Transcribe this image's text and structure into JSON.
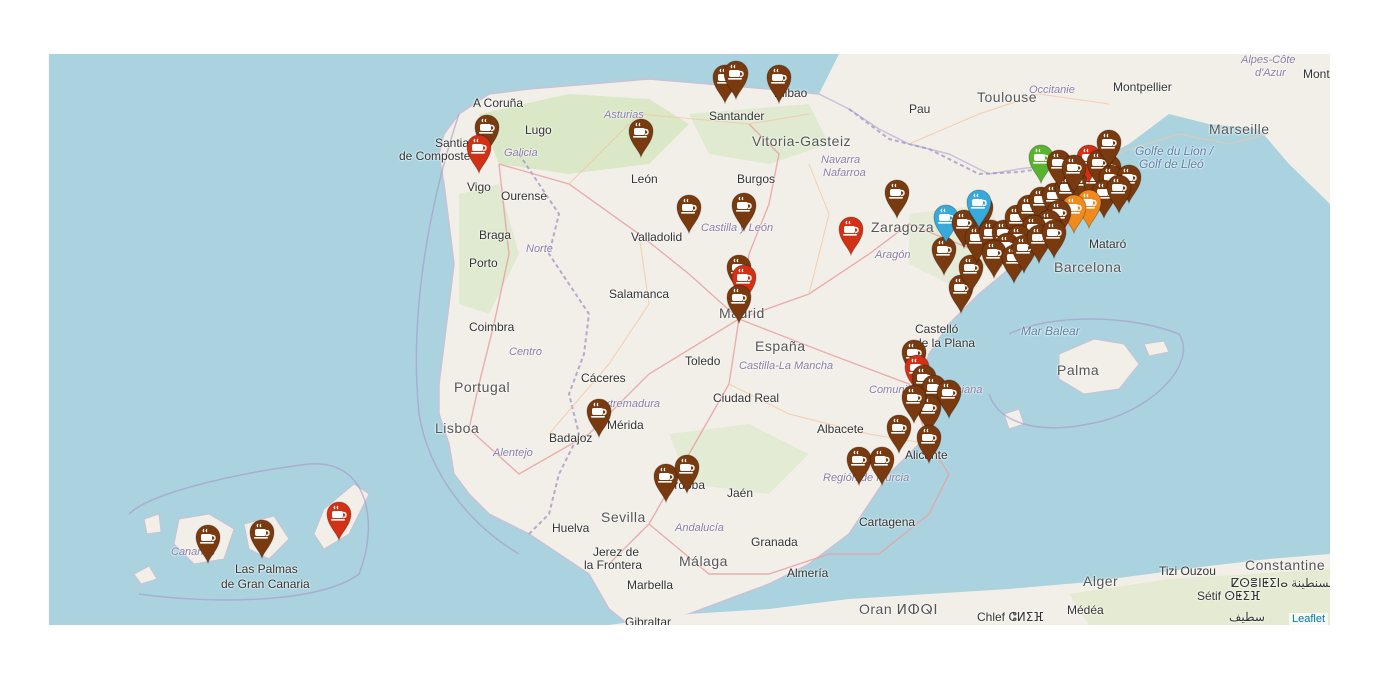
{
  "map": {
    "attribution": "Leaflet",
    "colors": {
      "sea": "#aad3df",
      "land": "#f2efe9",
      "green": "#cfe3b8",
      "marker_brown": "#7a3a0f",
      "marker_red": "#d33115",
      "marker_blue": "#38a9db",
      "marker_green": "#5ab430",
      "marker_orange": "#f08a1d"
    },
    "labels": [
      {
        "name": "label-a-coruna",
        "text": "A Coruña"
      },
      {
        "name": "label-lugo",
        "text": "Lugo"
      },
      {
        "name": "label-santiago-1",
        "text": "Santiago"
      },
      {
        "name": "label-santiago-2",
        "text": "de Compostela"
      },
      {
        "name": "label-galicia",
        "text": "Galicia"
      },
      {
        "name": "label-vigo",
        "text": "Vigo"
      },
      {
        "name": "label-ourense",
        "text": "Ourense"
      },
      {
        "name": "label-asturias",
        "text": "Asturias"
      },
      {
        "name": "label-santander",
        "text": "Santander"
      },
      {
        "name": "label-bilbao",
        "text": "Bilbao"
      },
      {
        "name": "label-vitoria",
        "text": "Vitoria-Gasteiz"
      },
      {
        "name": "label-navarra",
        "text": "Navarra"
      },
      {
        "name": "label-nafarroa",
        "text": "Nafarroa"
      },
      {
        "name": "label-pau",
        "text": "Pau"
      },
      {
        "name": "label-toulouse",
        "text": "Toulouse"
      },
      {
        "name": "label-occitanie",
        "text": "Occitanie"
      },
      {
        "name": "label-montpellier",
        "text": "Montpellier"
      },
      {
        "name": "label-marseille",
        "text": "Marseille"
      },
      {
        "name": "label-alpes",
        "text": "Alpes-Côte"
      },
      {
        "name": "label-azur",
        "text": "d'Azur"
      },
      {
        "name": "label-mont",
        "text": "Mont"
      },
      {
        "name": "label-golfe-lion",
        "text": "Golfe du Lion /"
      },
      {
        "name": "label-golf-lleo",
        "text": "Golf de Lleó"
      },
      {
        "name": "label-leon",
        "text": "León"
      },
      {
        "name": "label-burgos",
        "text": "Burgos"
      },
      {
        "name": "label-valladolid",
        "text": "Valladolid"
      },
      {
        "name": "label-castilla-leon",
        "text": "Castilla y León"
      },
      {
        "name": "label-zaragoza",
        "text": "Zaragoza"
      },
      {
        "name": "label-aragon",
        "text": "Aragón"
      },
      {
        "name": "label-braga",
        "text": "Braga"
      },
      {
        "name": "label-norte",
        "text": "Norte"
      },
      {
        "name": "label-porto",
        "text": "Porto"
      },
      {
        "name": "label-salamanca",
        "text": "Salamanca"
      },
      {
        "name": "label-madrid",
        "text": "Madrid"
      },
      {
        "name": "label-espana",
        "text": "España"
      },
      {
        "name": "label-barcelona",
        "text": "Barcelona"
      },
      {
        "name": "label-mataro",
        "text": "Mataró"
      },
      {
        "name": "label-coimbra",
        "text": "Coimbra"
      },
      {
        "name": "label-centro",
        "text": "Centro"
      },
      {
        "name": "label-castello",
        "text": "Castelló"
      },
      {
        "name": "label-la-plana",
        "text": "de la Plana"
      },
      {
        "name": "label-mar-balear",
        "text": "Mar Balear"
      },
      {
        "name": "label-toledo",
        "text": "Toledo"
      },
      {
        "name": "label-castilla-mancha",
        "text": "Castilla-La Mancha"
      },
      {
        "name": "label-portugal",
        "text": "Portugal"
      },
      {
        "name": "label-caceres",
        "text": "Cáceres"
      },
      {
        "name": "label-extremadura",
        "text": "Extremadura"
      },
      {
        "name": "label-merida",
        "text": "Mérida"
      },
      {
        "name": "label-ciudad-real",
        "text": "Ciudad Real"
      },
      {
        "name": "label-comunidad-valenciana",
        "text": "Comunidad Valenciana"
      },
      {
        "name": "label-palma",
        "text": "Palma"
      },
      {
        "name": "label-lisboa",
        "text": "Lisboa"
      },
      {
        "name": "label-badajoz",
        "text": "Badajoz"
      },
      {
        "name": "label-albacete",
        "text": "Albacete"
      },
      {
        "name": "label-alentejo",
        "text": "Alentejo"
      },
      {
        "name": "label-alicante",
        "text": "Alicante"
      },
      {
        "name": "label-cordoba",
        "text": "Córdoba"
      },
      {
        "name": "label-murcia",
        "text": "Región de Murcia"
      },
      {
        "name": "label-jaen",
        "text": "Jaén"
      },
      {
        "name": "label-sevilla",
        "text": "Sevilla"
      },
      {
        "name": "label-andalucia",
        "text": "Andalucía"
      },
      {
        "name": "label-huelva",
        "text": "Huelva"
      },
      {
        "name": "label-granada",
        "text": "Granada"
      },
      {
        "name": "label-cartagena",
        "text": "Cartagena"
      },
      {
        "name": "label-jerez-1",
        "text": "Jerez de"
      },
      {
        "name": "label-jerez-2",
        "text": "la Frontera"
      },
      {
        "name": "label-malaga",
        "text": "Málaga"
      },
      {
        "name": "label-almeria",
        "text": "Almería"
      },
      {
        "name": "label-marbella",
        "text": "Marbella"
      },
      {
        "name": "label-gibraltar",
        "text": "Gibraltar"
      },
      {
        "name": "label-canarias",
        "text": "Canarias"
      },
      {
        "name": "label-las-palmas-1",
        "text": "Las Palmas"
      },
      {
        "name": "label-las-palmas-2",
        "text": "de Gran Canaria"
      },
      {
        "name": "label-oran",
        "text": "Oran ⵍⵀⵕⵏ"
      },
      {
        "name": "label-chlef",
        "text": "Chlef ⵛⵍⵉⴼ"
      },
      {
        "name": "label-medea",
        "text": "Médéa"
      },
      {
        "name": "label-alger",
        "text": "Alger"
      },
      {
        "name": "label-tizi",
        "text": "Tizi Ouzou"
      },
      {
        "name": "label-setif",
        "text": "Sétif ⵙⵟⵉⴼ"
      },
      {
        "name": "label-constantine",
        "text": "Constantine"
      },
      {
        "name": "label-constantine-2",
        "text": "ⵇⵙⴻⵏⵟⵉⵏⴰ قسنطينة"
      },
      {
        "name": "label-setif-ar",
        "text": "سطيف"
      }
    ],
    "markers": [
      {
        "color": "brown",
        "icon": "coffee-cup-icon"
      },
      {
        "color": "red",
        "icon": "coffee-cup-icon"
      },
      {
        "color": "blue",
        "icon": "coffee-cup-icon"
      },
      {
        "color": "green",
        "icon": "coffee-cup-icon"
      },
      {
        "color": "orange",
        "icon": "coffee-cup-icon"
      }
    ]
  }
}
